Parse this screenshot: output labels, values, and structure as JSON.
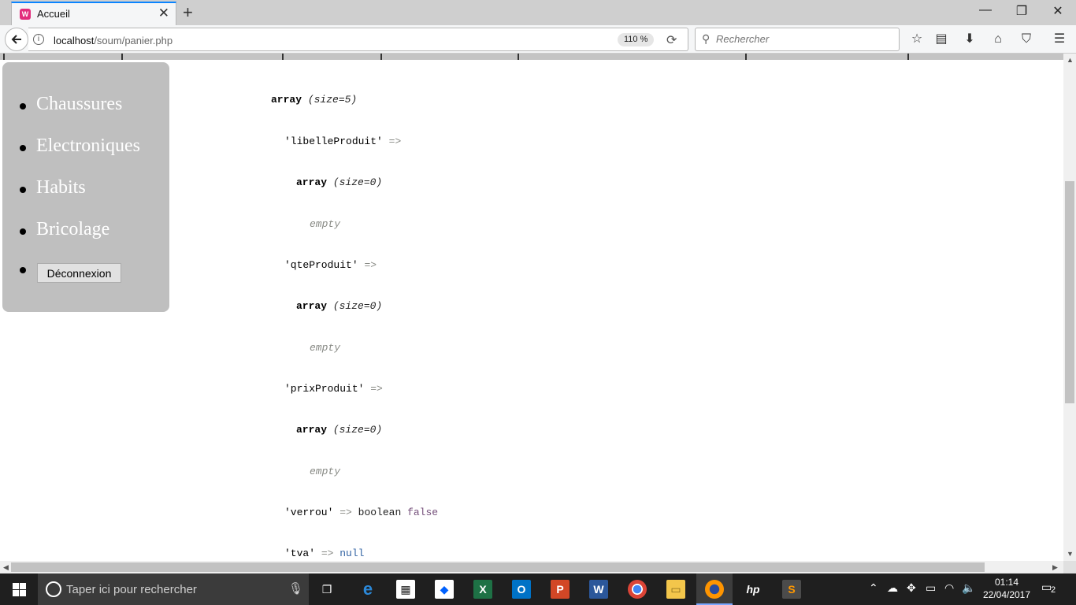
{
  "browser": {
    "tab_title": "Accueil",
    "tab_close": "✕",
    "new_tab": "+",
    "url_host": "localhost",
    "url_path": "/soum/panier.php",
    "zoom": "110 %",
    "search_placeholder": "Rechercher",
    "window_controls": {
      "minimize": "—",
      "restore": "❐",
      "close": "✕"
    }
  },
  "sidebar": {
    "categories": [
      {
        "label": "Chaussures"
      },
      {
        "label": "Electroniques"
      },
      {
        "label": "Habits"
      },
      {
        "label": "Bricolage"
      }
    ],
    "logout_label": "Déconnexion"
  },
  "dump": {
    "root_type": "array",
    "root_size": "(size=5)",
    "entries": [
      {
        "key": "'libelleProduit'",
        "arrow": "=>",
        "type": "array",
        "size": "(size=0)",
        "value": "empty"
      },
      {
        "key": "'qteProduit'",
        "arrow": "=>",
        "type": "array",
        "size": "(size=0)",
        "value": "empty"
      },
      {
        "key": "'prixProduit'",
        "arrow": "=>",
        "type": "array",
        "size": "(size=0)",
        "value": "empty"
      },
      {
        "key": "'verrou'",
        "arrow": "=>",
        "type": "boolean",
        "value": "false"
      },
      {
        "key": "'tva'",
        "arrow": "=>",
        "value": "null"
      }
    ]
  },
  "taskbar": {
    "search_placeholder": "Taper ici pour rechercher",
    "apps": [
      "task-view",
      "edge",
      "store",
      "dropbox",
      "excel",
      "outlook",
      "powerpoint",
      "word",
      "chrome",
      "file-explorer",
      "firefox",
      "hp",
      "sublime-text"
    ],
    "time": "01:14",
    "date": "22/04/2017",
    "notification_count": "2"
  },
  "colors": {
    "sidebar_bg": "#bfbfbf",
    "tab_accent": "#0a84ff",
    "xdebug_bool": "#75507b",
    "xdebug_null": "#3465a4",
    "xdebug_muted": "#888a85"
  }
}
